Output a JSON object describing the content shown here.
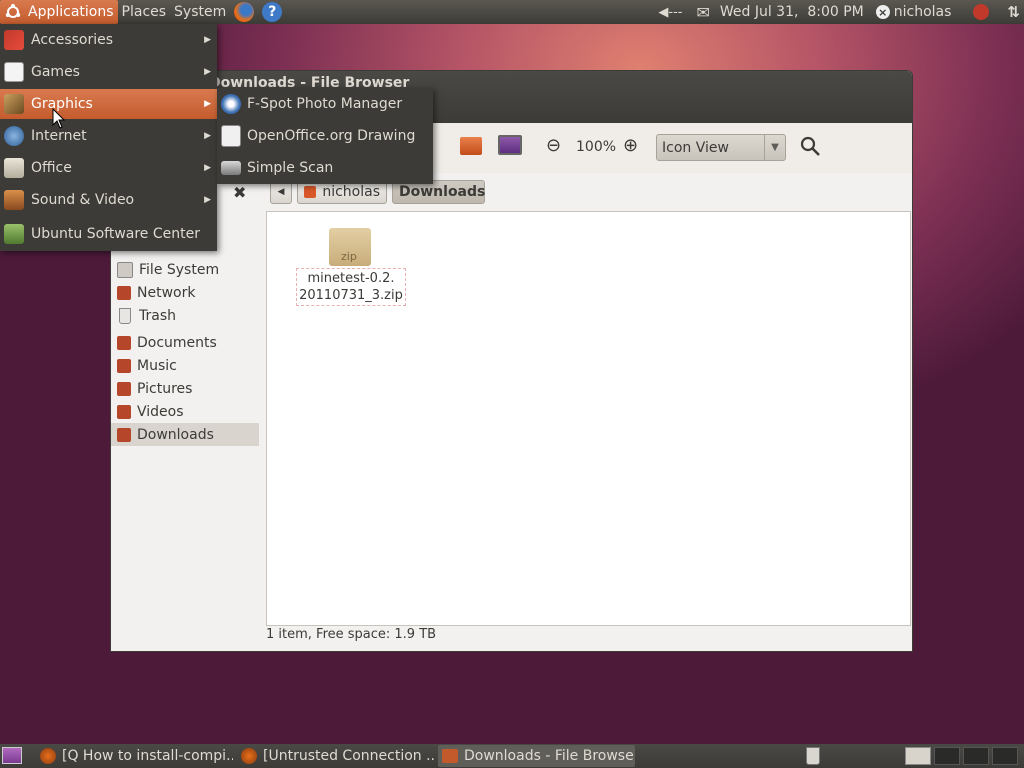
{
  "top_panel": {
    "menus": [
      "Applications",
      "Places",
      "System"
    ],
    "date_time": "Wed Jul 31,  8:00 PM",
    "user": "nicholas",
    "icons": [
      "ubuntu-logo-icon",
      "firefox-icon",
      "help-icon",
      "volume-icon",
      "mail-icon",
      "user-status-icon",
      "power-icon",
      "network-icon"
    ]
  },
  "apps_menu": {
    "items": [
      "Accessories",
      "Games",
      "Graphics",
      "Internet",
      "Office",
      "Sound & Video",
      "Ubuntu Software Center"
    ],
    "active": "Graphics"
  },
  "graphics_submenu": {
    "items": [
      "F-Spot Photo Manager",
      "OpenOffice.org Drawing",
      "Simple Scan"
    ]
  },
  "window": {
    "title": "Downloads - File Browser",
    "zoom": "100%",
    "view_mode": "Icon View",
    "path": [
      "nicholas",
      "Downloads"
    ],
    "sidebar": [
      "File System",
      "Network",
      "Trash",
      "Documents",
      "Music",
      "Pictures",
      "Videos",
      "Downloads"
    ],
    "selected_place": "Downloads",
    "file": {
      "name_line1": "minetest-0.2.",
      "name_line2": "20110731_3.zip",
      "type_label": "zip"
    },
    "status": "1 item, Free space: 1.9 TB"
  },
  "taskbar": {
    "tasks": [
      "[Q How to install-compi...",
      "[Untrusted Connection ...",
      "Downloads - File Browser"
    ],
    "active_task": "Downloads - File Browser"
  },
  "colors": {
    "panel": "#3c3b37",
    "accent": "#d87a4e",
    "desktop": "#7a2e52"
  }
}
